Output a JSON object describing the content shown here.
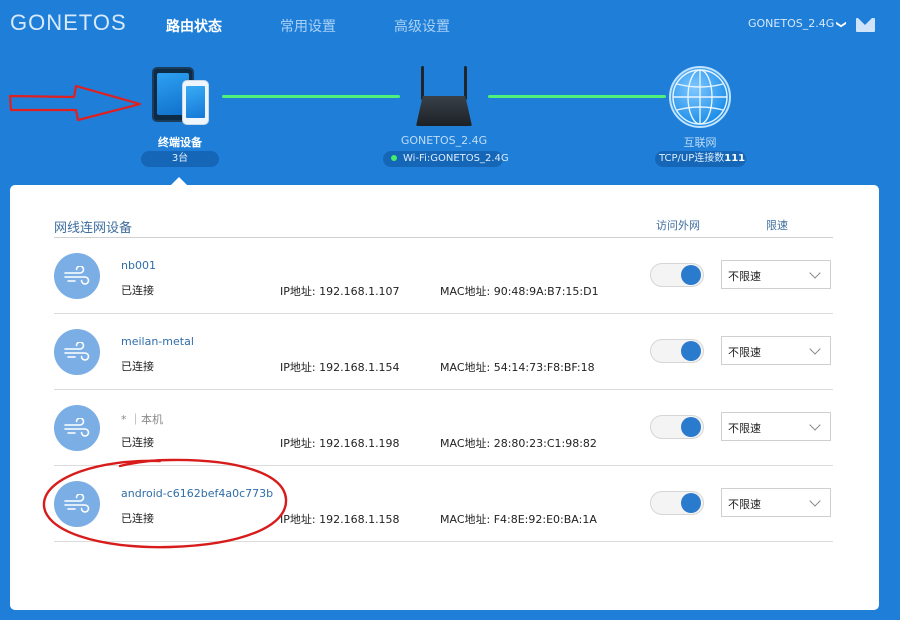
{
  "brand": "GONETOS",
  "nav": [
    {
      "label": "路由状态",
      "active": true
    },
    {
      "label": "常用设置",
      "active": false
    },
    {
      "label": "高级设置",
      "active": false
    }
  ],
  "header": {
    "ssid": "GONETOS_2.4G",
    "chev": "❯"
  },
  "topology": {
    "terminal": {
      "label": "终端设备",
      "count": "3台"
    },
    "router": {
      "label": "GONETOS_2.4G",
      "wifi": "Wi-Fi:GONETOS_2.4G"
    },
    "internet": {
      "label": "互联网",
      "conn_prefix": "TCP/UP连接数",
      "conn_count": "111"
    }
  },
  "section": {
    "title": "网线连网设备",
    "col_access": "访问外网",
    "col_speed": "限速"
  },
  "devices": [
    {
      "name": "nb001",
      "status": "已连接",
      "ip": "IP地址: 192.168.1.107",
      "mac": "MAC地址: 90:48:9A:B7:15:D1",
      "speed": "不限速",
      "access": true
    },
    {
      "name": "meilan-metal",
      "status": "已连接",
      "ip": "IP地址: 192.168.1.154",
      "mac": "MAC地址: 54:14:73:F8:BF:18",
      "speed": "不限速",
      "access": true
    },
    {
      "name": "* ｜本机",
      "status": "已连接",
      "ip": "IP地址: 192.168.1.198",
      "mac": "MAC地址: 28:80:23:C1:98:82",
      "speed": "不限速",
      "access": true
    },
    {
      "name": "android-c6162bef4a0c773b",
      "status": "已连接",
      "ip": "IP地址: 192.168.1.158",
      "mac": "MAC地址: F4:8E:92:E0:BA:1A",
      "speed": "不限速",
      "access": true
    }
  ],
  "colors": {
    "bg": "#1f7fd8",
    "link": "#4ef27a",
    "annotation": "#e02020",
    "toggle_on": "#2a7acd"
  },
  "icons": [
    "mail-icon",
    "tablet-phone-icon",
    "router-icon",
    "globe-icon",
    "wind-icon",
    "chevron-down-icon"
  ]
}
